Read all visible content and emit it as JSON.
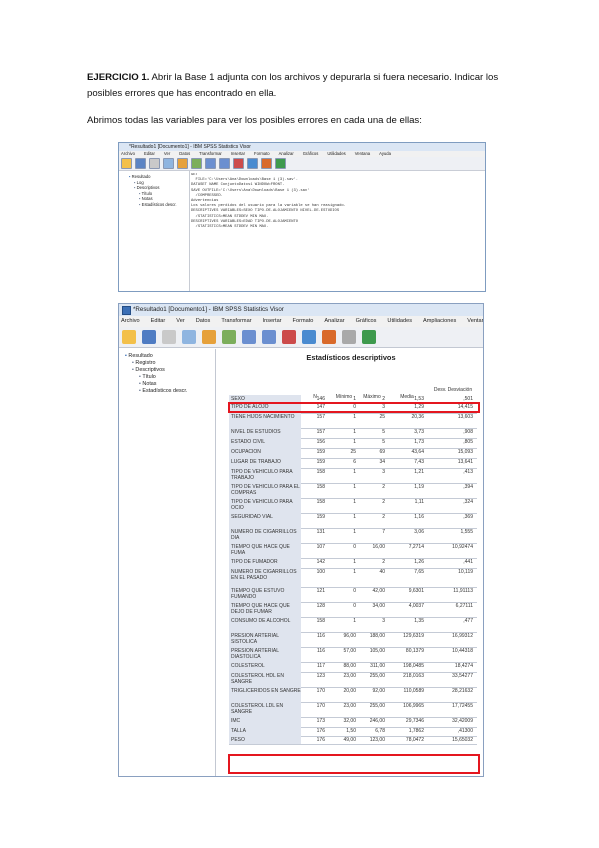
{
  "heading": {
    "label": "EJERCICIO 1.",
    "text": "Abrir la Base 1 adjunta con los archivos y depurarla si fuera necesario. Indicar los posibles errores que has encontrado en ella."
  },
  "intro": "Abrimos todas las variables para ver los posibles errores en cada una de ellas:",
  "window1": {
    "title": "*Resultado1 [Documento1] - IBM SPSS Statistics Visor",
    "menu": [
      "Archivo",
      "Editar",
      "Ver",
      "Datos",
      "Transformar",
      "Insertar",
      "Formato",
      "Analizar",
      "Gráficos",
      "Utilidades",
      "Ventana",
      "Ayuda"
    ],
    "tree": [
      "Resultado",
      "Log",
      "Descriptivos",
      "Título",
      "Notas",
      "Estadísticos descr."
    ],
    "log_lines": [
      "GET",
      "  FILE='C:\\Users\\Ana\\Downloads\\Base 1 (3).sav'.",
      "DATASET NAME ConjuntoDatos1 WINDOW=FRONT.",
      "SAVE OUTFILE='C:\\Users\\Ana\\Downloads\\Base 1 (3).sav'",
      "  /COMPRESSED.",
      "Advertencias",
      "Los valores perdidos del usuario para la variable se han reasignado.",
      "DESCRIPTIVES VARIABLES=SEXO TIPO.DE.ALOJAMIENTO NIVEL.DE.ESTUDIOS",
      "  /STATISTICS=MEAN STDDEV MIN MAX.",
      "DESCRIPTIVES VARIABLES=EDAD TIPO.DE.ALOJAMIENTO",
      "  /STATISTICS=MEAN STDDEV MIN MAX."
    ]
  },
  "window2": {
    "title": "*Resultado1 [Documento1] - IBM SPSS Statistics Visor",
    "menu": [
      "Archivo",
      "Editar",
      "Ver",
      "Datos",
      "Transformar",
      "Insertar",
      "Formato",
      "Analizar",
      "Gráficos",
      "Utilidades",
      "Ampliaciones",
      "Ventana"
    ],
    "tree": [
      "Resultado",
      "Registro",
      "Descriptivos",
      "Título",
      "Notas",
      "Estadísticos descr."
    ],
    "table": {
      "title": "Estadísticos descriptivos",
      "headers": [
        "N",
        "Mínimo",
        "Máximo",
        "Media",
        "Desv. Desviación"
      ],
      "rows": [
        {
          "label": "SEXO",
          "n": "146",
          "min": "1",
          "max": "2",
          "mean": "1,53",
          "sd": ",501"
        },
        {
          "label": "TIPO DE ALOJO",
          "n": "147",
          "min": "0",
          "max": "3",
          "mean": "1,29",
          "sd": "14,415"
        },
        {
          "label": "TIENE HIJOS NACIMIENTO",
          "n": "157",
          "min": "1",
          "max": "25",
          "mean": "20,36",
          "sd": "13,603"
        },
        {
          "label": "NIVEL DE ESTUDIOS",
          "n": "157",
          "min": "1",
          "max": "5",
          "mean": "3,73",
          "sd": ",908"
        },
        {
          "label": "ESTADO CIVIL",
          "n": "156",
          "min": "1",
          "max": "5",
          "mean": "1,73",
          "sd": ",805"
        },
        {
          "label": "OCUPACION",
          "n": "159",
          "min": "25",
          "max": "69",
          "mean": "43,64",
          "sd": "15,093"
        },
        {
          "label": "LUGAR DE TRABAJO",
          "n": "159",
          "min": "6",
          "max": "34",
          "mean": "7,43",
          "sd": "13,641"
        },
        {
          "label": "TIPO DE VEHICULO PARA TRABAJO",
          "n": "158",
          "min": "1",
          "max": "3",
          "mean": "1,21",
          "sd": ",413"
        },
        {
          "label": "TIPO DE VEHICULO PARA EL COMPRAS",
          "n": "158",
          "min": "1",
          "max": "2",
          "mean": "1,19",
          "sd": ",394"
        },
        {
          "label": "TIPO DE VEHICULO PARA OCIO",
          "n": "158",
          "min": "1",
          "max": "2",
          "mean": "1,11",
          "sd": ",324"
        },
        {
          "label": "SEGURIDAD VIAL",
          "n": "159",
          "min": "1",
          "max": "2",
          "mean": "1,16",
          "sd": ",369"
        },
        {
          "label": "NUMERO DE CIGARRILLOS DIA",
          "n": "131",
          "min": "1",
          "max": "7",
          "mean": "3,06",
          "sd": "1,555"
        },
        {
          "label": "TIEMPO QUE HACE QUE FUMA",
          "n": "107",
          "min": "0",
          "max": "16,00",
          "mean": "7,2714",
          "sd": "10,92474"
        },
        {
          "label": "TIPO DE FUMADOR",
          "n": "142",
          "min": "1",
          "max": "2",
          "mean": "1,26",
          "sd": ",441"
        },
        {
          "label": "NUMERO DE CIGARRILLOS EN EL PASADO",
          "n": "100",
          "min": "1",
          "max": "40",
          "mean": "7,65",
          "sd": "10,119"
        },
        {
          "label": "TIEMPO QUE ESTUVO FUMANDO",
          "n": "121",
          "min": "0",
          "max": "42,00",
          "mean": "9,6301",
          "sd": "11,91113"
        },
        {
          "label": "TIEMPO QUE HACE QUE DEJO DE FUMAR",
          "n": "128",
          "min": "0",
          "max": "34,00",
          "mean": "4,0037",
          "sd": "6,27111"
        },
        {
          "label": "CONSUMO DE ALCOHOL",
          "n": "158",
          "min": "1",
          "max": "3",
          "mean": "1,35",
          "sd": ",477"
        },
        {
          "label": "PRESION ARTERIAL SISTOLICA",
          "n": "116",
          "min": "96,00",
          "max": "188,00",
          "mean": "129,6319",
          "sd": "16,99312"
        },
        {
          "label": "PRESION ARTERIAL DIASTOLICA",
          "n": "116",
          "min": "57,00",
          "max": "105,00",
          "mean": "80,1379",
          "sd": "10,44318"
        },
        {
          "label": "COLESTEROL",
          "n": "117",
          "min": "88,00",
          "max": "311,00",
          "mean": "198,0485",
          "sd": "18,4274"
        },
        {
          "label": "COLESTEROL HDL EN SANGRE",
          "n": "123",
          "min": "23,00",
          "max": "255,00",
          "mean": "218,0163",
          "sd": "33,54277"
        },
        {
          "label": "TRIGLICERIDOS EN SANGRE",
          "n": "170",
          "min": "20,00",
          "max": "92,00",
          "mean": "110,0589",
          "sd": "28,21632"
        },
        {
          "label": "COLESTEROL LDL EN SANGRE",
          "n": "170",
          "min": "23,00",
          "max": "255,00",
          "mean": "106,9965",
          "sd": "17,72455"
        },
        {
          "label": "IMC",
          "n": "173",
          "min": "32,00",
          "max": "246,00",
          "mean": "29,7346",
          "sd": "32,42009"
        },
        {
          "label": "TALLA",
          "n": "176",
          "min": "1,50",
          "max": "6,78",
          "mean": "1,7862",
          "sd": ",41300"
        },
        {
          "label": "PESO",
          "n": "176",
          "min": "49,00",
          "max": "123,00",
          "mean": "78,0472",
          "sd": "15,65032"
        }
      ]
    }
  },
  "accent": {
    "highlight": "#e4161f",
    "window_title_bg": "#dbe6f4",
    "row_label_bg": "#dfe4ee"
  }
}
